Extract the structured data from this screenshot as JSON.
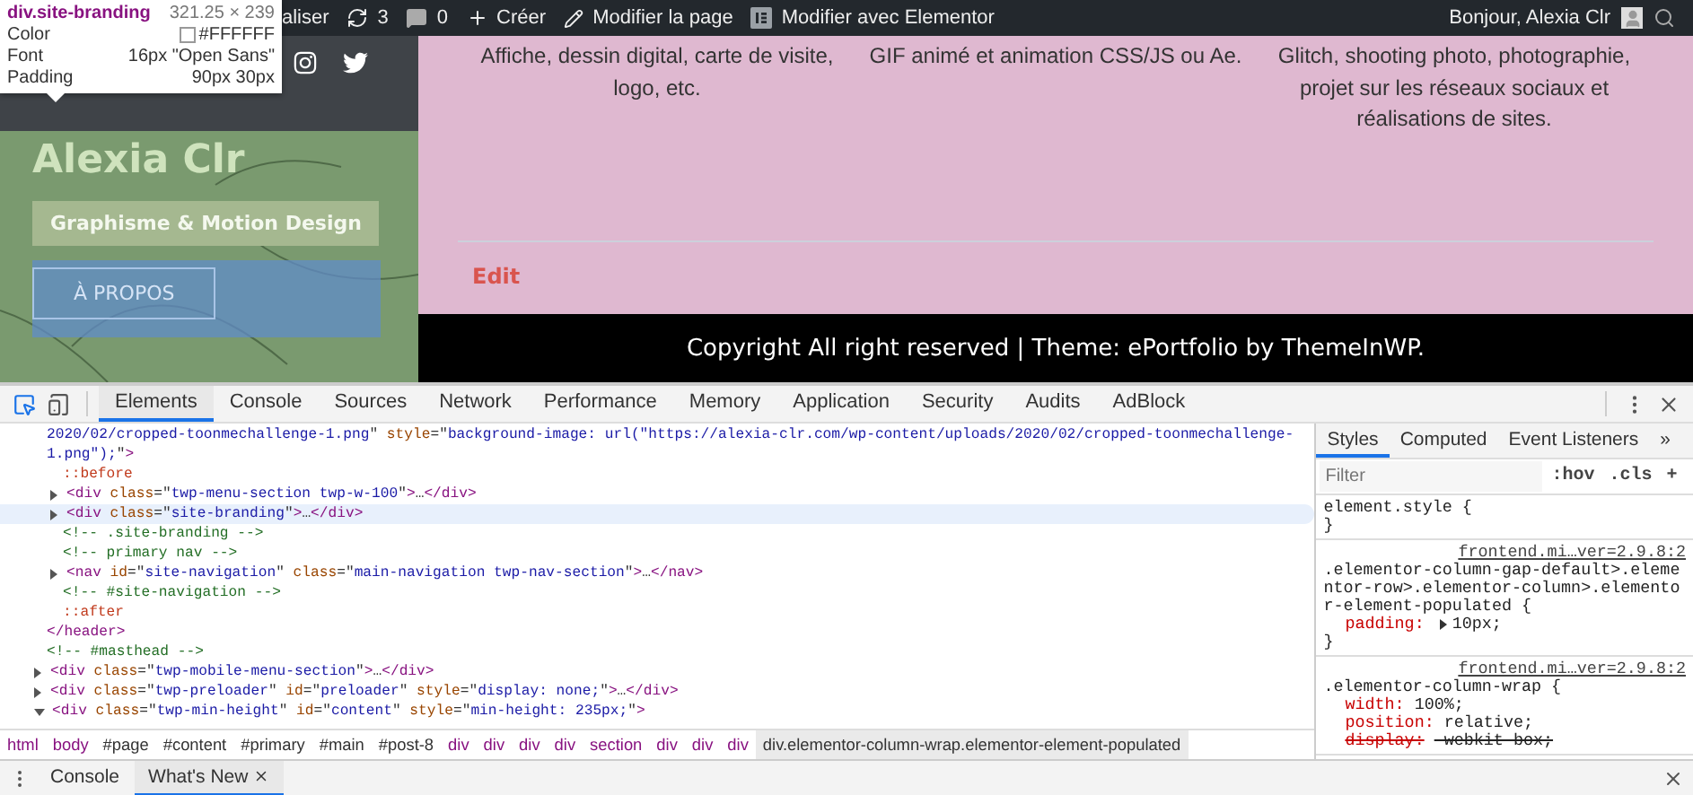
{
  "admin_bar": {
    "items": [
      {
        "kind": "text",
        "label": "aliser"
      },
      {
        "kind": "updates",
        "label": "3"
      },
      {
        "kind": "comments",
        "label": "0"
      },
      {
        "kind": "new",
        "label": "Créer"
      },
      {
        "kind": "edit",
        "label": "Modifier la page"
      },
      {
        "kind": "elementor",
        "label": "Modifier avec Elementor"
      }
    ],
    "greeting": "Bonjour, Alexia Clr"
  },
  "inspector_tooltip": {
    "selector": "div.site-branding",
    "size": "321.25 × 239",
    "rows": [
      {
        "kind": "color",
        "name": "Color",
        "value": "#FFFFFF"
      },
      {
        "kind": "text",
        "name": "Font",
        "value": "16px \"Open Sans\""
      },
      {
        "kind": "text",
        "name": "Padding",
        "value": "90px 30px"
      }
    ]
  },
  "site_header": {
    "title": "Alexia Clr",
    "tagline": "Graphisme & Motion Design",
    "button": "À PROPOS"
  },
  "services": [
    "Affiche, dessin digital, carte de visite, logo, etc.",
    "GIF animé et animation CSS/JS ou Ae.",
    "Glitch, shooting photo, photographie, projet sur les réseaux sociaux et réalisations de sites."
  ],
  "edit_link": "Edit",
  "footer": "Copyright All right reserved | Theme: ePortfolio by ThemeInWP.",
  "devtools": {
    "tabs": [
      {
        "label": "Elements",
        "selected": true
      },
      {
        "label": "Console",
        "selected": false
      },
      {
        "label": "Sources",
        "selected": false
      },
      {
        "label": "Network",
        "selected": false
      },
      {
        "label": "Performance",
        "selected": false
      },
      {
        "label": "Memory",
        "selected": false
      },
      {
        "label": "Application",
        "selected": false
      },
      {
        "label": "Security",
        "selected": false
      },
      {
        "label": "Audits",
        "selected": false
      },
      {
        "label": "AdBlock",
        "selected": false
      }
    ],
    "dom": [
      {
        "selected": false,
        "lines": [
          [
            {
              "kind": "val",
              "text": "2020/02/cropped-toonmechallenge-1.png"
            },
            {
              "kind": "punct",
              "text": "\""
            },
            {
              "kind": "attr",
              "text": " style"
            },
            {
              "kind": "punct",
              "text": "=\""
            },
            {
              "kind": "val",
              "text": "background-image: url(\"https://alexia-clr.com/wp-content/uploads/2020/02/cropped-toonmechallenge-"
            }
          ],
          [
            {
              "kind": "val",
              "text": "1.png\");"
            },
            {
              "kind": "punct",
              "text": "\""
            },
            {
              "kind": "tag",
              "text": ">"
            }
          ]
        ],
        "children": [
          {
            "selected": false,
            "lines": [
              [
                {
                  "kind": "pseudo",
                  "text": "::before"
                }
              ]
            ]
          },
          {
            "selected": false,
            "expanded": false,
            "lines": [
              [
                {
                  "kind": "tag",
                  "text": "<div"
                },
                {
                  "kind": "attr",
                  "text": " class"
                },
                {
                  "kind": "punct",
                  "text": "=\""
                },
                {
                  "kind": "val",
                  "text": "twp-menu-section twp-w-100"
                },
                {
                  "kind": "punct",
                  "text": "\""
                },
                {
                  "kind": "tag",
                  "text": ">"
                },
                {
                  "kind": "punct",
                  "text": "…"
                },
                {
                  "kind": "tag",
                  "text": "</div>"
                }
              ]
            ]
          },
          {
            "selected": true,
            "expanded": false,
            "lines": [
              [
                {
                  "kind": "tag",
                  "text": "<div"
                },
                {
                  "kind": "attr",
                  "text": " class"
                },
                {
                  "kind": "punct",
                  "text": "=\""
                },
                {
                  "kind": "val",
                  "text": "site-branding"
                },
                {
                  "kind": "punct",
                  "text": "\""
                },
                {
                  "kind": "tag",
                  "text": ">"
                },
                {
                  "kind": "punct",
                  "text": "…"
                },
                {
                  "kind": "tag",
                  "text": "</div>"
                }
              ]
            ]
          },
          {
            "selected": false,
            "lines": [
              [
                {
                  "kind": "comment",
                  "text": "<!-- .site-branding -->"
                }
              ]
            ]
          },
          {
            "selected": false,
            "lines": [
              [
                {
                  "kind": "comment",
                  "text": "<!-- primary nav -->"
                }
              ]
            ]
          },
          {
            "selected": false,
            "expanded": false,
            "lines": [
              [
                {
                  "kind": "tag",
                  "text": "<nav"
                },
                {
                  "kind": "attr",
                  "text": " id"
                },
                {
                  "kind": "punct",
                  "text": "=\""
                },
                {
                  "kind": "val",
                  "text": "site-navigation"
                },
                {
                  "kind": "punct",
                  "text": "\""
                },
                {
                  "kind": "attr",
                  "text": " class"
                },
                {
                  "kind": "punct",
                  "text": "=\""
                },
                {
                  "kind": "val",
                  "text": "main-navigation twp-nav-section"
                },
                {
                  "kind": "punct",
                  "text": "\""
                },
                {
                  "kind": "tag",
                  "text": ">"
                },
                {
                  "kind": "punct",
                  "text": "…"
                },
                {
                  "kind": "tag",
                  "text": "</nav>"
                }
              ]
            ]
          },
          {
            "selected": false,
            "lines": [
              [
                {
                  "kind": "comment",
                  "text": "<!-- #site-navigation -->"
                }
              ]
            ]
          },
          {
            "selected": false,
            "lines": [
              [
                {
                  "kind": "pseudo",
                  "text": "::after"
                }
              ]
            ]
          }
        ]
      },
      {
        "selected": false,
        "lines": [
          [
            {
              "kind": "tag",
              "text": "</header>"
            }
          ]
        ]
      },
      {
        "selected": false,
        "lines": [
          [
            {
              "kind": "comment",
              "text": "<!-- #masthead -->"
            }
          ]
        ]
      },
      {
        "selected": false,
        "expanded": false,
        "lines": [
          [
            {
              "kind": "tag",
              "text": "<div"
            },
            {
              "kind": "attr",
              "text": " class"
            },
            {
              "kind": "punct",
              "text": "=\""
            },
            {
              "kind": "val",
              "text": "twp-mobile-menu-section"
            },
            {
              "kind": "punct",
              "text": "\""
            },
            {
              "kind": "tag",
              "text": ">"
            },
            {
              "kind": "punct",
              "text": "…"
            },
            {
              "kind": "tag",
              "text": "</div>"
            }
          ]
        ]
      },
      {
        "selected": false,
        "expanded": false,
        "lines": [
          [
            {
              "kind": "tag",
              "text": "<div"
            },
            {
              "kind": "attr",
              "text": " class"
            },
            {
              "kind": "punct",
              "text": "=\""
            },
            {
              "kind": "val",
              "text": "twp-preloader"
            },
            {
              "kind": "punct",
              "text": "\""
            },
            {
              "kind": "attr",
              "text": " id"
            },
            {
              "kind": "punct",
              "text": "=\""
            },
            {
              "kind": "val",
              "text": "preloader"
            },
            {
              "kind": "punct",
              "text": "\""
            },
            {
              "kind": "attr",
              "text": " style"
            },
            {
              "kind": "punct",
              "text": "=\""
            },
            {
              "kind": "val",
              "text": "display: none;"
            },
            {
              "kind": "punct",
              "text": "\""
            },
            {
              "kind": "tag",
              "text": ">"
            },
            {
              "kind": "punct",
              "text": "…"
            },
            {
              "kind": "tag",
              "text": "</div>"
            }
          ]
        ]
      },
      {
        "selected": false,
        "expanded": true,
        "lines": [
          [
            {
              "kind": "tag",
              "text": "<div"
            },
            {
              "kind": "attr",
              "text": " class"
            },
            {
              "kind": "punct",
              "text": "=\""
            },
            {
              "kind": "val",
              "text": "twp-min-height"
            },
            {
              "kind": "punct",
              "text": "\""
            },
            {
              "kind": "attr",
              "text": " id"
            },
            {
              "kind": "punct",
              "text": "=\""
            },
            {
              "kind": "val",
              "text": "content"
            },
            {
              "kind": "punct",
              "text": "\""
            },
            {
              "kind": "attr",
              "text": " style"
            },
            {
              "kind": "punct",
              "text": "=\""
            },
            {
              "kind": "val",
              "text": "min-height: 235px;"
            },
            {
              "kind": "punct",
              "text": "\""
            },
            {
              "kind": "tag",
              "text": ">"
            }
          ]
        ]
      }
    ],
    "breadcrumbs": [
      {
        "kind": "tag",
        "label": "html",
        "selected": false
      },
      {
        "kind": "tag",
        "label": "body",
        "selected": false
      },
      {
        "kind": "id",
        "label": "#page",
        "selected": false
      },
      {
        "kind": "id",
        "label": "#content",
        "selected": false
      },
      {
        "kind": "id",
        "label": "#primary",
        "selected": false
      },
      {
        "kind": "id",
        "label": "#main",
        "selected": false
      },
      {
        "kind": "id",
        "label": "#post-8",
        "selected": false
      },
      {
        "kind": "tag",
        "label": "div",
        "selected": false
      },
      {
        "kind": "tag",
        "label": "div",
        "selected": false
      },
      {
        "kind": "tag",
        "label": "div",
        "selected": false
      },
      {
        "kind": "tag",
        "label": "div",
        "selected": false
      },
      {
        "kind": "tag",
        "label": "section",
        "selected": false
      },
      {
        "kind": "tag",
        "label": "div",
        "selected": false
      },
      {
        "kind": "tag",
        "label": "div",
        "selected": false
      },
      {
        "kind": "tag",
        "label": "div",
        "selected": false
      },
      {
        "kind": "id",
        "label": "div.elementor-column-wrap.elementor-element-populated",
        "selected": true
      }
    ],
    "styles_tabs": [
      {
        "label": "Styles",
        "selected": true
      },
      {
        "label": "Computed",
        "selected": false
      },
      {
        "label": "Event Listeners",
        "selected": false
      }
    ],
    "more_tabs": "»",
    "filter": {
      "placeholder": "Filter"
    },
    "filter_buttons": [
      ":hov",
      ".cls",
      "+"
    ],
    "rules": [
      {
        "selector": "element.style {",
        "close": "}"
      },
      {
        "selector": ".elementor-column-gap-default>.elementor-row>.elementor-column>.elementor-element-populated {",
        "source": "frontend.mi…ver=2.9.8:2",
        "close": "}",
        "props": [
          {
            "name": "padding:",
            "value": "10px;",
            "expandable": true,
            "struck": false
          }
        ]
      },
      {
        "selector": ".elementor-column-wrap {",
        "source": "frontend.mi…ver=2.9.8:2",
        "props": [
          {
            "name": "width:",
            "value": "100%;",
            "struck": false
          },
          {
            "name": "position:",
            "value": "relative;",
            "struck": false
          },
          {
            "name": "display:",
            "value": "-webkit-box;",
            "struck": true
          }
        ]
      }
    ],
    "drawer_tabs": [
      {
        "label": "Console",
        "selected": false,
        "closable": false
      },
      {
        "label": "What's New",
        "selected": true,
        "closable": true
      }
    ]
  }
}
